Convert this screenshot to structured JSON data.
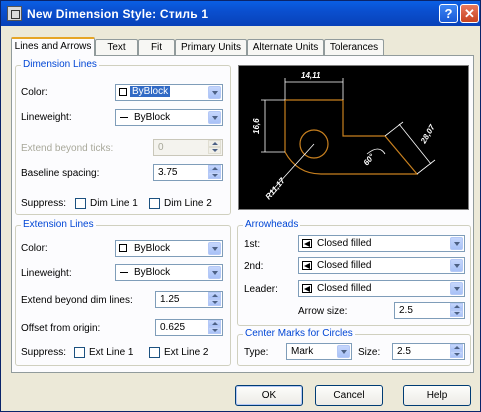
{
  "window": {
    "title": "New Dimension Style: Стиль 1",
    "help_glyph": "?",
    "close_glyph": "✕"
  },
  "tabs": [
    {
      "label": "Lines and Arrows",
      "active": true
    },
    {
      "label": "Text"
    },
    {
      "label": "Fit"
    },
    {
      "label": "Primary Units"
    },
    {
      "label": "Alternate Units"
    },
    {
      "label": "Tolerances"
    }
  ],
  "dimension_lines": {
    "title": "Dimension Lines",
    "color_label": "Color:",
    "color_value": "ByBlock",
    "lineweight_label": "Lineweight:",
    "lineweight_value": "ByBlock",
    "extend_label": "Extend beyond ticks:",
    "extend_value": "0",
    "baseline_label": "Baseline spacing:",
    "baseline_value": "3.75",
    "suppress_label": "Suppress:",
    "dim_line1": "Dim Line 1",
    "dim_line2": "Dim Line 2"
  },
  "extension_lines": {
    "title": "Extension Lines",
    "color_label": "Color:",
    "color_value": "ByBlock",
    "lineweight_label": "Lineweight:",
    "lineweight_value": "ByBlock",
    "extend_label": "Extend beyond dim lines:",
    "extend_value": "1.25",
    "offset_label": "Offset from origin:",
    "offset_value": "0.625",
    "suppress_label": "Suppress:",
    "ext_line1": "Ext Line 1",
    "ext_line2": "Ext Line 2"
  },
  "preview": {
    "dim_top": "14,11",
    "dim_left": "16,6",
    "dim_right": "28,07",
    "dim_angle": "60°",
    "dim_radius": "R11,17"
  },
  "arrowheads": {
    "title": "Arrowheads",
    "first_label": "1st:",
    "first_value": "Closed filled",
    "second_label": "2nd:",
    "second_value": "Closed filled",
    "leader_label": "Leader:",
    "leader_value": "Closed filled",
    "size_label": "Arrow size:",
    "size_value": "2.5"
  },
  "center_marks": {
    "title": "Center Marks for Circles",
    "type_label": "Type:",
    "type_value": "Mark",
    "size_label": "Size:",
    "size_value": "2.5"
  },
  "buttons": {
    "ok": "OK",
    "cancel": "Cancel",
    "help": "Help"
  },
  "colors": {
    "preview_bg": "#000000",
    "preview_geometry": "#c8801f",
    "preview_dims": "#ffffff",
    "group_title": "#0046d5"
  }
}
